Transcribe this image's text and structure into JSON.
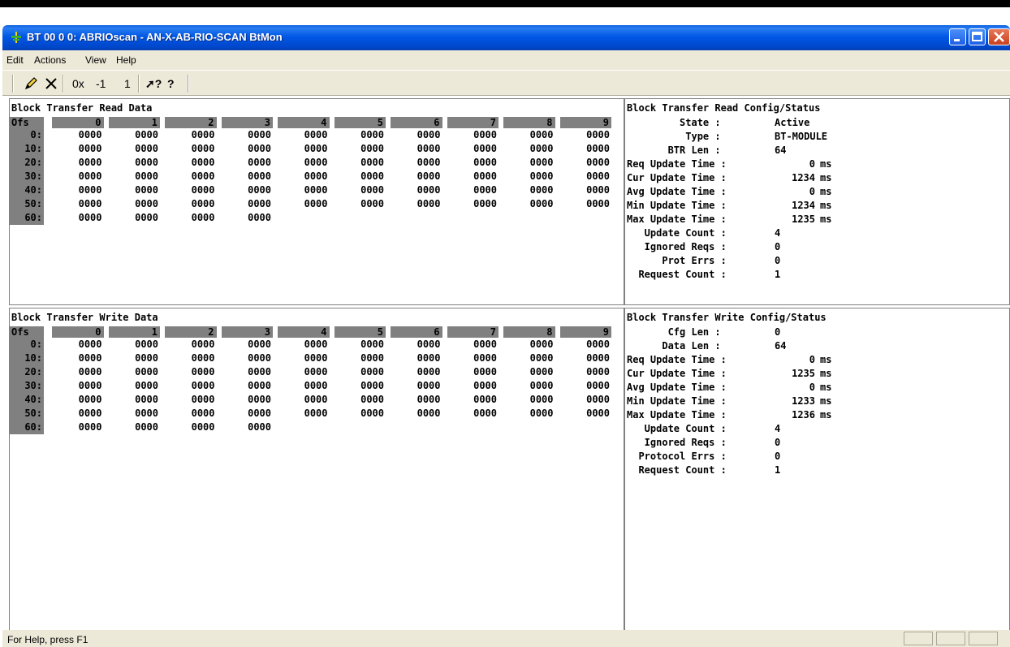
{
  "window": {
    "title": "BT 00 0 0: ABRIOscan - AN-X-AB-RIO-SCAN BtMon"
  },
  "menu": [
    "Edit",
    "Actions",
    "View",
    "Help"
  ],
  "toolbar": {
    "hex_label": "0x",
    "minus_one": "-1",
    "one": "1",
    "context_help": "?",
    "help": "?"
  },
  "read_pane": {
    "title": "Block Transfer Read Data",
    "ofs_label": "Ofs",
    "columns": [
      "0",
      "1",
      "2",
      "3",
      "4",
      "5",
      "6",
      "7",
      "8",
      "9"
    ],
    "rows": [
      {
        "ofs": "0:",
        "values": [
          "0000",
          "0000",
          "0000",
          "0000",
          "0000",
          "0000",
          "0000",
          "0000",
          "0000",
          "0000"
        ]
      },
      {
        "ofs": "10:",
        "values": [
          "0000",
          "0000",
          "0000",
          "0000",
          "0000",
          "0000",
          "0000",
          "0000",
          "0000",
          "0000"
        ]
      },
      {
        "ofs": "20:",
        "values": [
          "0000",
          "0000",
          "0000",
          "0000",
          "0000",
          "0000",
          "0000",
          "0000",
          "0000",
          "0000"
        ]
      },
      {
        "ofs": "30:",
        "values": [
          "0000",
          "0000",
          "0000",
          "0000",
          "0000",
          "0000",
          "0000",
          "0000",
          "0000",
          "0000"
        ]
      },
      {
        "ofs": "40:",
        "values": [
          "0000",
          "0000",
          "0000",
          "0000",
          "0000",
          "0000",
          "0000",
          "0000",
          "0000",
          "0000"
        ]
      },
      {
        "ofs": "50:",
        "values": [
          "0000",
          "0000",
          "0000",
          "0000",
          "0000",
          "0000",
          "0000",
          "0000",
          "0000",
          "0000"
        ]
      },
      {
        "ofs": "60:",
        "values": [
          "0000",
          "0000",
          "0000",
          "0000"
        ]
      }
    ]
  },
  "read_config": {
    "title": "Block Transfer Read Config/Status",
    "rows": [
      {
        "label": "         State :",
        "value": "Active",
        "unit": ""
      },
      {
        "label": "          Type :",
        "value": "BT-MODULE",
        "unit": ""
      },
      {
        "label": "       BTR Len :",
        "value": "64",
        "unit": ""
      },
      {
        "label": "Req Update Time :",
        "value": "0",
        "unit": "ms"
      },
      {
        "label": "Cur Update Time :",
        "value": "1234",
        "unit": "ms"
      },
      {
        "label": "Avg Update Time :",
        "value": "0",
        "unit": "ms"
      },
      {
        "label": "Min Update Time :",
        "value": "1234",
        "unit": "ms"
      },
      {
        "label": "Max Update Time :",
        "value": "1235",
        "unit": "ms"
      },
      {
        "label": "   Update Count :",
        "value": "4",
        "unit": ""
      },
      {
        "label": "   Ignored Reqs :",
        "value": "0",
        "unit": ""
      },
      {
        "label": "      Prot Errs :",
        "value": "0",
        "unit": ""
      },
      {
        "label": "  Request Count :",
        "value": "1",
        "unit": ""
      }
    ]
  },
  "write_pane": {
    "title": "Block Transfer Write Data",
    "ofs_label": "Ofs",
    "columns": [
      "0",
      "1",
      "2",
      "3",
      "4",
      "5",
      "6",
      "7",
      "8",
      "9"
    ],
    "rows": [
      {
        "ofs": "0:",
        "values": [
          "0000",
          "0000",
          "0000",
          "0000",
          "0000",
          "0000",
          "0000",
          "0000",
          "0000",
          "0000"
        ]
      },
      {
        "ofs": "10:",
        "values": [
          "0000",
          "0000",
          "0000",
          "0000",
          "0000",
          "0000",
          "0000",
          "0000",
          "0000",
          "0000"
        ]
      },
      {
        "ofs": "20:",
        "values": [
          "0000",
          "0000",
          "0000",
          "0000",
          "0000",
          "0000",
          "0000",
          "0000",
          "0000",
          "0000"
        ]
      },
      {
        "ofs": "30:",
        "values": [
          "0000",
          "0000",
          "0000",
          "0000",
          "0000",
          "0000",
          "0000",
          "0000",
          "0000",
          "0000"
        ]
      },
      {
        "ofs": "40:",
        "values": [
          "0000",
          "0000",
          "0000",
          "0000",
          "0000",
          "0000",
          "0000",
          "0000",
          "0000",
          "0000"
        ]
      },
      {
        "ofs": "50:",
        "values": [
          "0000",
          "0000",
          "0000",
          "0000",
          "0000",
          "0000",
          "0000",
          "0000",
          "0000",
          "0000"
        ]
      },
      {
        "ofs": "60:",
        "values": [
          "0000",
          "0000",
          "0000",
          "0000"
        ]
      }
    ]
  },
  "write_config": {
    "title": "Block Transfer Write Config/Status",
    "rows": [
      {
        "label": "       Cfg Len :",
        "value": "0",
        "unit": ""
      },
      {
        "label": "      Data Len :",
        "value": "64",
        "unit": ""
      },
      {
        "label": "Req Update Time :",
        "value": "0",
        "unit": "ms"
      },
      {
        "label": "Cur Update Time :",
        "value": "1235",
        "unit": "ms"
      },
      {
        "label": "Avg Update Time :",
        "value": "0",
        "unit": "ms"
      },
      {
        "label": "Min Update Time :",
        "value": "1233",
        "unit": "ms"
      },
      {
        "label": "Max Update Time :",
        "value": "1236",
        "unit": "ms"
      },
      {
        "label": "   Update Count :",
        "value": "4",
        "unit": ""
      },
      {
        "label": "   Ignored Reqs :",
        "value": "0",
        "unit": ""
      },
      {
        "label": "  Protocol Errs :",
        "value": "0",
        "unit": ""
      },
      {
        "label": "  Request Count :",
        "value": "1",
        "unit": ""
      }
    ]
  },
  "status_bar": {
    "text": "For Help, press F1"
  },
  "colors": {
    "titlebar": "#0058e6",
    "chrome": "#ece9d8",
    "header_gray": "#808080"
  }
}
